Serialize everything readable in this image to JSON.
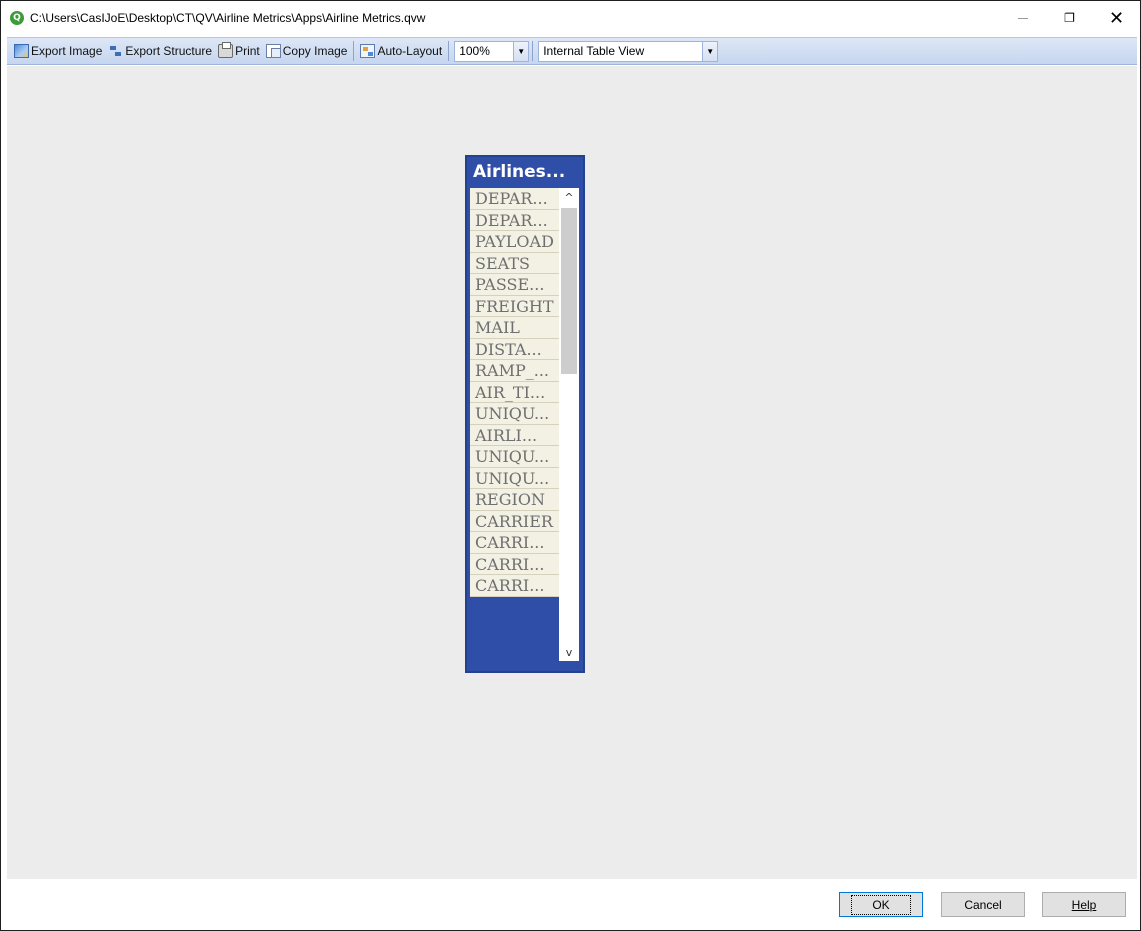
{
  "window": {
    "title": "C:\\Users\\CasIJoE\\Desktop\\CT\\QV\\Airline Metrics\\Apps\\Airline Metrics.qvw",
    "app_icon_letter": "Q",
    "close_glyph": "✕",
    "restore_glyph": "❐"
  },
  "toolbar": {
    "export_image": "Export Image",
    "export_structure": "Export Structure",
    "print": "Print",
    "copy_image": "Copy Image",
    "auto_layout": "Auto-Layout",
    "zoom": "100%",
    "view": "Internal Table View",
    "dropdown_glyph": "▼"
  },
  "table": {
    "title": "Airlines...",
    "fields": [
      "DEPAR...",
      "DEPAR...",
      "PAYLOAD",
      "SEATS",
      "PASSE...",
      "FREIGHT",
      "MAIL",
      "DISTA...",
      "RAMP_...",
      "AIR_TI...",
      "UNIQU...",
      "AIRLI...",
      "UNIQU...",
      "UNIQU...",
      "REGION",
      "CARRIER",
      "CARRI...",
      "CARRI...",
      "CARRI..."
    ],
    "scroll_up_glyph": "^",
    "scroll_down_glyph": "v"
  },
  "buttons": {
    "ok": "OK",
    "cancel": "Cancel",
    "help": "Help"
  },
  "colors": {
    "table_header": "#2f4ea8",
    "canvas_bg": "#ececec",
    "toolbar_bg": "#c6d6ef",
    "field_bg": "#f3f0e4"
  }
}
